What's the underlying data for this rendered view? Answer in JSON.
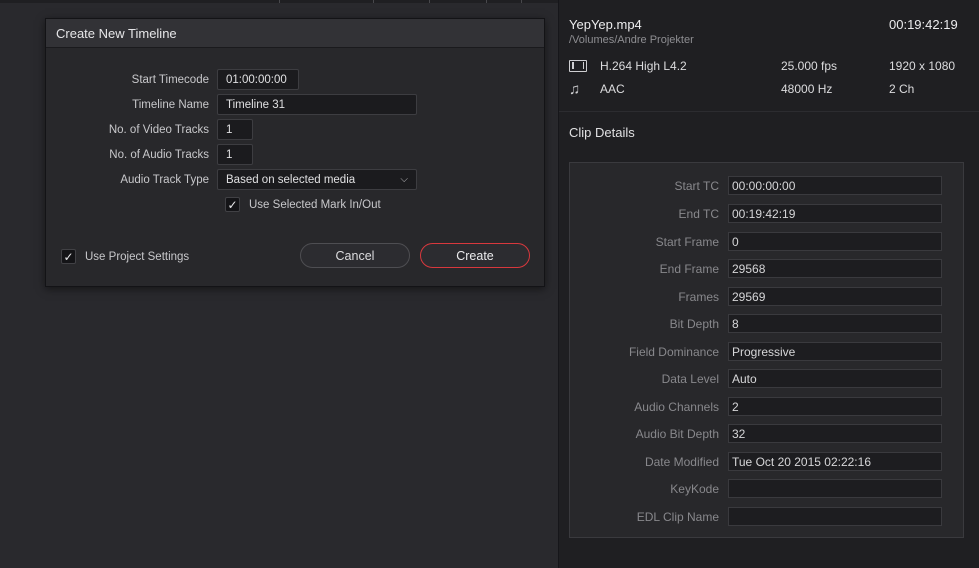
{
  "dialog": {
    "title": "Create New Timeline",
    "start_timecode": {
      "label": "Start Timecode",
      "value": "01:00:00:00"
    },
    "timeline_name": {
      "label": "Timeline Name",
      "value": "Timeline 31"
    },
    "video_tracks": {
      "label": "No. of Video Tracks",
      "value": "1"
    },
    "audio_tracks": {
      "label": "No. of Audio Tracks",
      "value": "1"
    },
    "audio_track_type": {
      "label": "Audio Track Type",
      "value": "Based on selected media"
    },
    "use_mark": {
      "label": "Use Selected Mark In/Out",
      "checked": true
    },
    "use_project_settings": {
      "label": "Use Project Settings",
      "checked": true
    },
    "cancel_label": "Cancel",
    "create_label": "Create",
    "create_accent": "#d8383d"
  },
  "clip": {
    "name": "YepYep.mp4",
    "duration": "00:19:42:19",
    "path": "/Volumes/Andre Projekter",
    "video": {
      "icon": "film-icon",
      "codec": "H.264 High L4.2",
      "fps": "25.000 fps",
      "resolution": "1920 x 1080"
    },
    "audio": {
      "icon": "music-note-icon",
      "codec": "AAC",
      "rate": "48000 Hz",
      "channels": "2 Ch"
    }
  },
  "details": {
    "title": "Clip Details",
    "rows": [
      {
        "label": "Start TC",
        "value": "00:00:00:00"
      },
      {
        "label": "End TC",
        "value": "00:19:42:19"
      },
      {
        "label": "Start Frame",
        "value": "0"
      },
      {
        "label": "End Frame",
        "value": "29568"
      },
      {
        "label": "Frames",
        "value": "29569"
      },
      {
        "label": "Bit Depth",
        "value": "8"
      },
      {
        "label": "Field Dominance",
        "value": "Progressive"
      },
      {
        "label": "Data Level",
        "value": "Auto"
      },
      {
        "label": "Audio Channels",
        "value": "2"
      },
      {
        "label": "Audio Bit Depth",
        "value": "32"
      },
      {
        "label": "Date Modified",
        "value": "Tue Oct 20 2015 02:22:16"
      },
      {
        "label": "KeyKode",
        "value": ""
      },
      {
        "label": "EDL Clip Name",
        "value": ""
      }
    ]
  }
}
